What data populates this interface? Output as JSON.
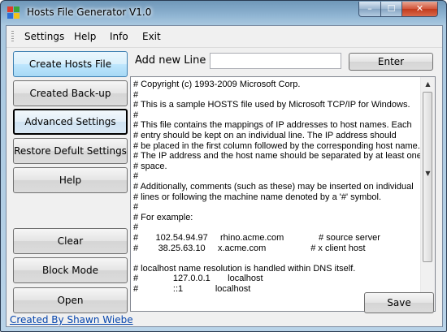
{
  "window": {
    "title": "Hosts File Generator V1.0",
    "controls": {
      "minimize": "–",
      "maximize": "☐",
      "close": "✕"
    }
  },
  "menu": [
    "Settings",
    "Help",
    "Info",
    "Exit"
  ],
  "sidebar": {
    "buttons": [
      {
        "label": "Create Hosts File"
      },
      {
        "label": "Created Back-up"
      },
      {
        "label": "Advanced Settings"
      },
      {
        "label": "Restore Defult Settings"
      },
      {
        "label": "Help"
      },
      {
        "label": "Clear"
      },
      {
        "label": "Block Mode"
      },
      {
        "label": "Open"
      }
    ]
  },
  "add_line": {
    "label": "Add new Line",
    "value": "",
    "enter_label": "Enter"
  },
  "hosts_text": "# Copyright (c) 1993-2009 Microsoft Corp.\n#\n# This is a sample HOSTS file used by Microsoft TCP/IP for Windows.\n#\n# This file contains the mappings of IP addresses to host names. Each\n# entry should be kept on an individual line. The IP address should\n# be placed in the first column followed by the corresponding host name.\n# The IP address and the host name should be separated by at least one\n# space.\n#\n# Additionally, comments (such as these) may be inserted on individual\n# lines or following the machine name denoted by a '#' symbol.\n#\n# For example:\n#\n#       102.54.94.97     rhino.acme.com              # source server\n#        38.25.63.10     x.acme.com                  # x client host\n\n# localhost name resolution is handled within DNS itself.\n#              127.0.0.1       localhost\n#              ::1             localhost",
  "save_label": "Save",
  "credit": "Created By Shawn Wiebe",
  "scroll": {
    "up": "▲",
    "down": "▼"
  },
  "colors": {
    "accent": "#3c7fb1",
    "link": "#0645ad"
  }
}
